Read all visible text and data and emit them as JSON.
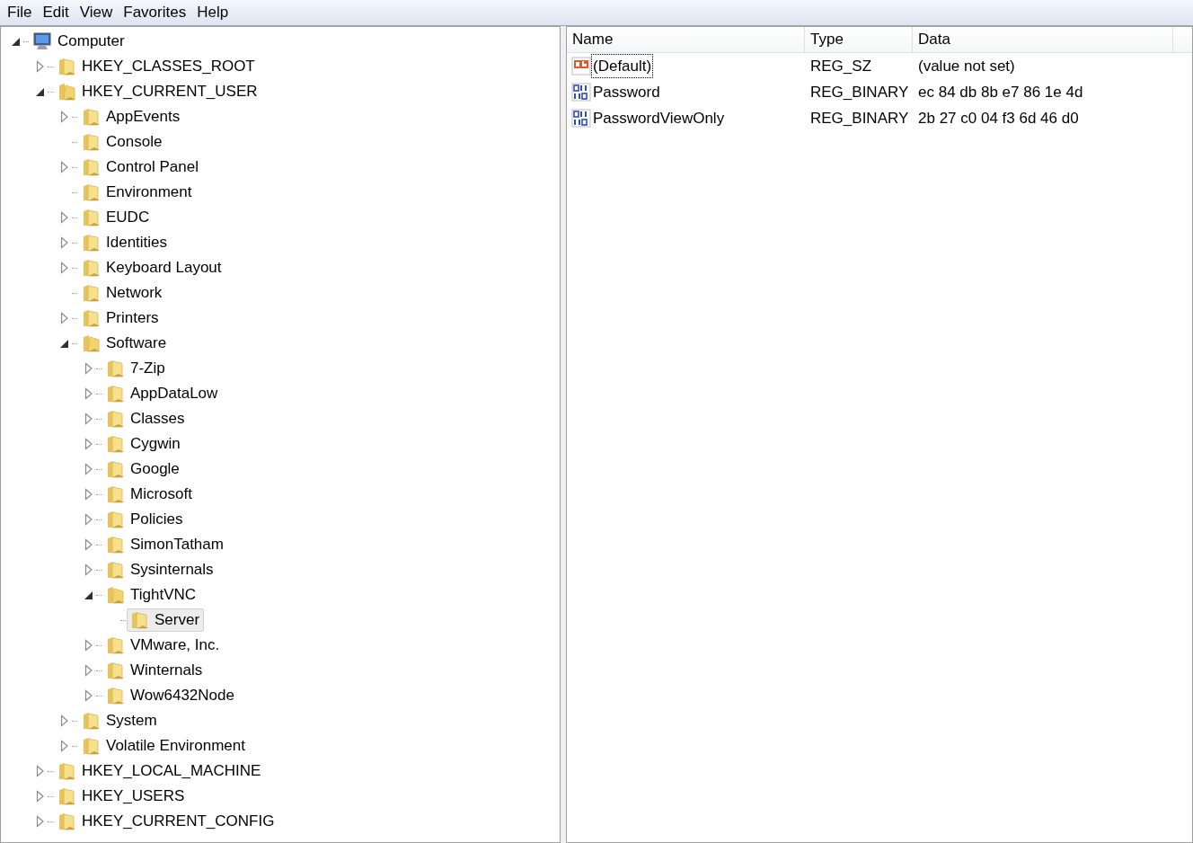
{
  "menu": [
    "File",
    "Edit",
    "View",
    "Favorites",
    "Help"
  ],
  "tree": [
    {
      "label": "Computer",
      "kind": "computer",
      "expanded": true,
      "selected": false,
      "children": [
        {
          "label": "HKEY_CLASSES_ROOT",
          "kind": "expandable",
          "expanded": false,
          "selected": false
        },
        {
          "label": "HKEY_CURRENT_USER",
          "kind": "expandable",
          "expanded": true,
          "selected": false,
          "children": [
            {
              "label": "AppEvents",
              "kind": "expandable",
              "expanded": false,
              "selected": false
            },
            {
              "label": "Console",
              "kind": "leaf",
              "selected": false
            },
            {
              "label": "Control Panel",
              "kind": "expandable",
              "expanded": false,
              "selected": false
            },
            {
              "label": "Environment",
              "kind": "leaf",
              "selected": false
            },
            {
              "label": "EUDC",
              "kind": "expandable",
              "expanded": false,
              "selected": false
            },
            {
              "label": "Identities",
              "kind": "expandable",
              "expanded": false,
              "selected": false
            },
            {
              "label": "Keyboard Layout",
              "kind": "expandable",
              "expanded": false,
              "selected": false
            },
            {
              "label": "Network",
              "kind": "leaf",
              "selected": false
            },
            {
              "label": "Printers",
              "kind": "expandable",
              "expanded": false,
              "selected": false
            },
            {
              "label": "Software",
              "kind": "expandable",
              "expanded": true,
              "selected": false,
              "children": [
                {
                  "label": "7-Zip",
                  "kind": "expandable",
                  "expanded": false,
                  "selected": false
                },
                {
                  "label": "AppDataLow",
                  "kind": "expandable",
                  "expanded": false,
                  "selected": false
                },
                {
                  "label": "Classes",
                  "kind": "expandable",
                  "expanded": false,
                  "selected": false
                },
                {
                  "label": "Cygwin",
                  "kind": "expandable",
                  "expanded": false,
                  "selected": false
                },
                {
                  "label": "Google",
                  "kind": "expandable",
                  "expanded": false,
                  "selected": false
                },
                {
                  "label": "Microsoft",
                  "kind": "expandable",
                  "expanded": false,
                  "selected": false
                },
                {
                  "label": "Policies",
                  "kind": "expandable",
                  "expanded": false,
                  "selected": false
                },
                {
                  "label": "SimonTatham",
                  "kind": "expandable",
                  "expanded": false,
                  "selected": false
                },
                {
                  "label": "Sysinternals",
                  "kind": "expandable",
                  "expanded": false,
                  "selected": false
                },
                {
                  "label": "TightVNC",
                  "kind": "expandable",
                  "expanded": true,
                  "selected": false,
                  "children": [
                    {
                      "label": "Server",
                      "kind": "leaf",
                      "selected": true
                    }
                  ]
                },
                {
                  "label": "VMware, Inc.",
                  "kind": "expandable",
                  "expanded": false,
                  "selected": false
                },
                {
                  "label": "Winternals",
                  "kind": "expandable",
                  "expanded": false,
                  "selected": false
                },
                {
                  "label": "Wow6432Node",
                  "kind": "expandable",
                  "expanded": false,
                  "selected": false
                }
              ]
            },
            {
              "label": "System",
              "kind": "expandable",
              "expanded": false,
              "selected": false
            },
            {
              "label": "Volatile Environment",
              "kind": "expandable",
              "expanded": false,
              "selected": false
            }
          ]
        },
        {
          "label": "HKEY_LOCAL_MACHINE",
          "kind": "expandable",
          "expanded": false,
          "selected": false
        },
        {
          "label": "HKEY_USERS",
          "kind": "expandable",
          "expanded": false,
          "selected": false
        },
        {
          "label": "HKEY_CURRENT_CONFIG",
          "kind": "expandable",
          "expanded": false,
          "selected": false
        }
      ]
    }
  ],
  "columns": [
    "Name",
    "Type",
    "Data"
  ],
  "values": [
    {
      "name": "(Default)",
      "kind": "string",
      "type": "REG_SZ",
      "data": "(value not set)",
      "focused": true
    },
    {
      "name": "Password",
      "kind": "binary",
      "type": "REG_BINARY",
      "data": "ec 84 db 8b e7 86 1e 4d",
      "focused": false
    },
    {
      "name": "PasswordViewOnly",
      "kind": "binary",
      "type": "REG_BINARY",
      "data": "2b 27 c0 04 f3 6d 46 d0",
      "focused": false
    }
  ]
}
